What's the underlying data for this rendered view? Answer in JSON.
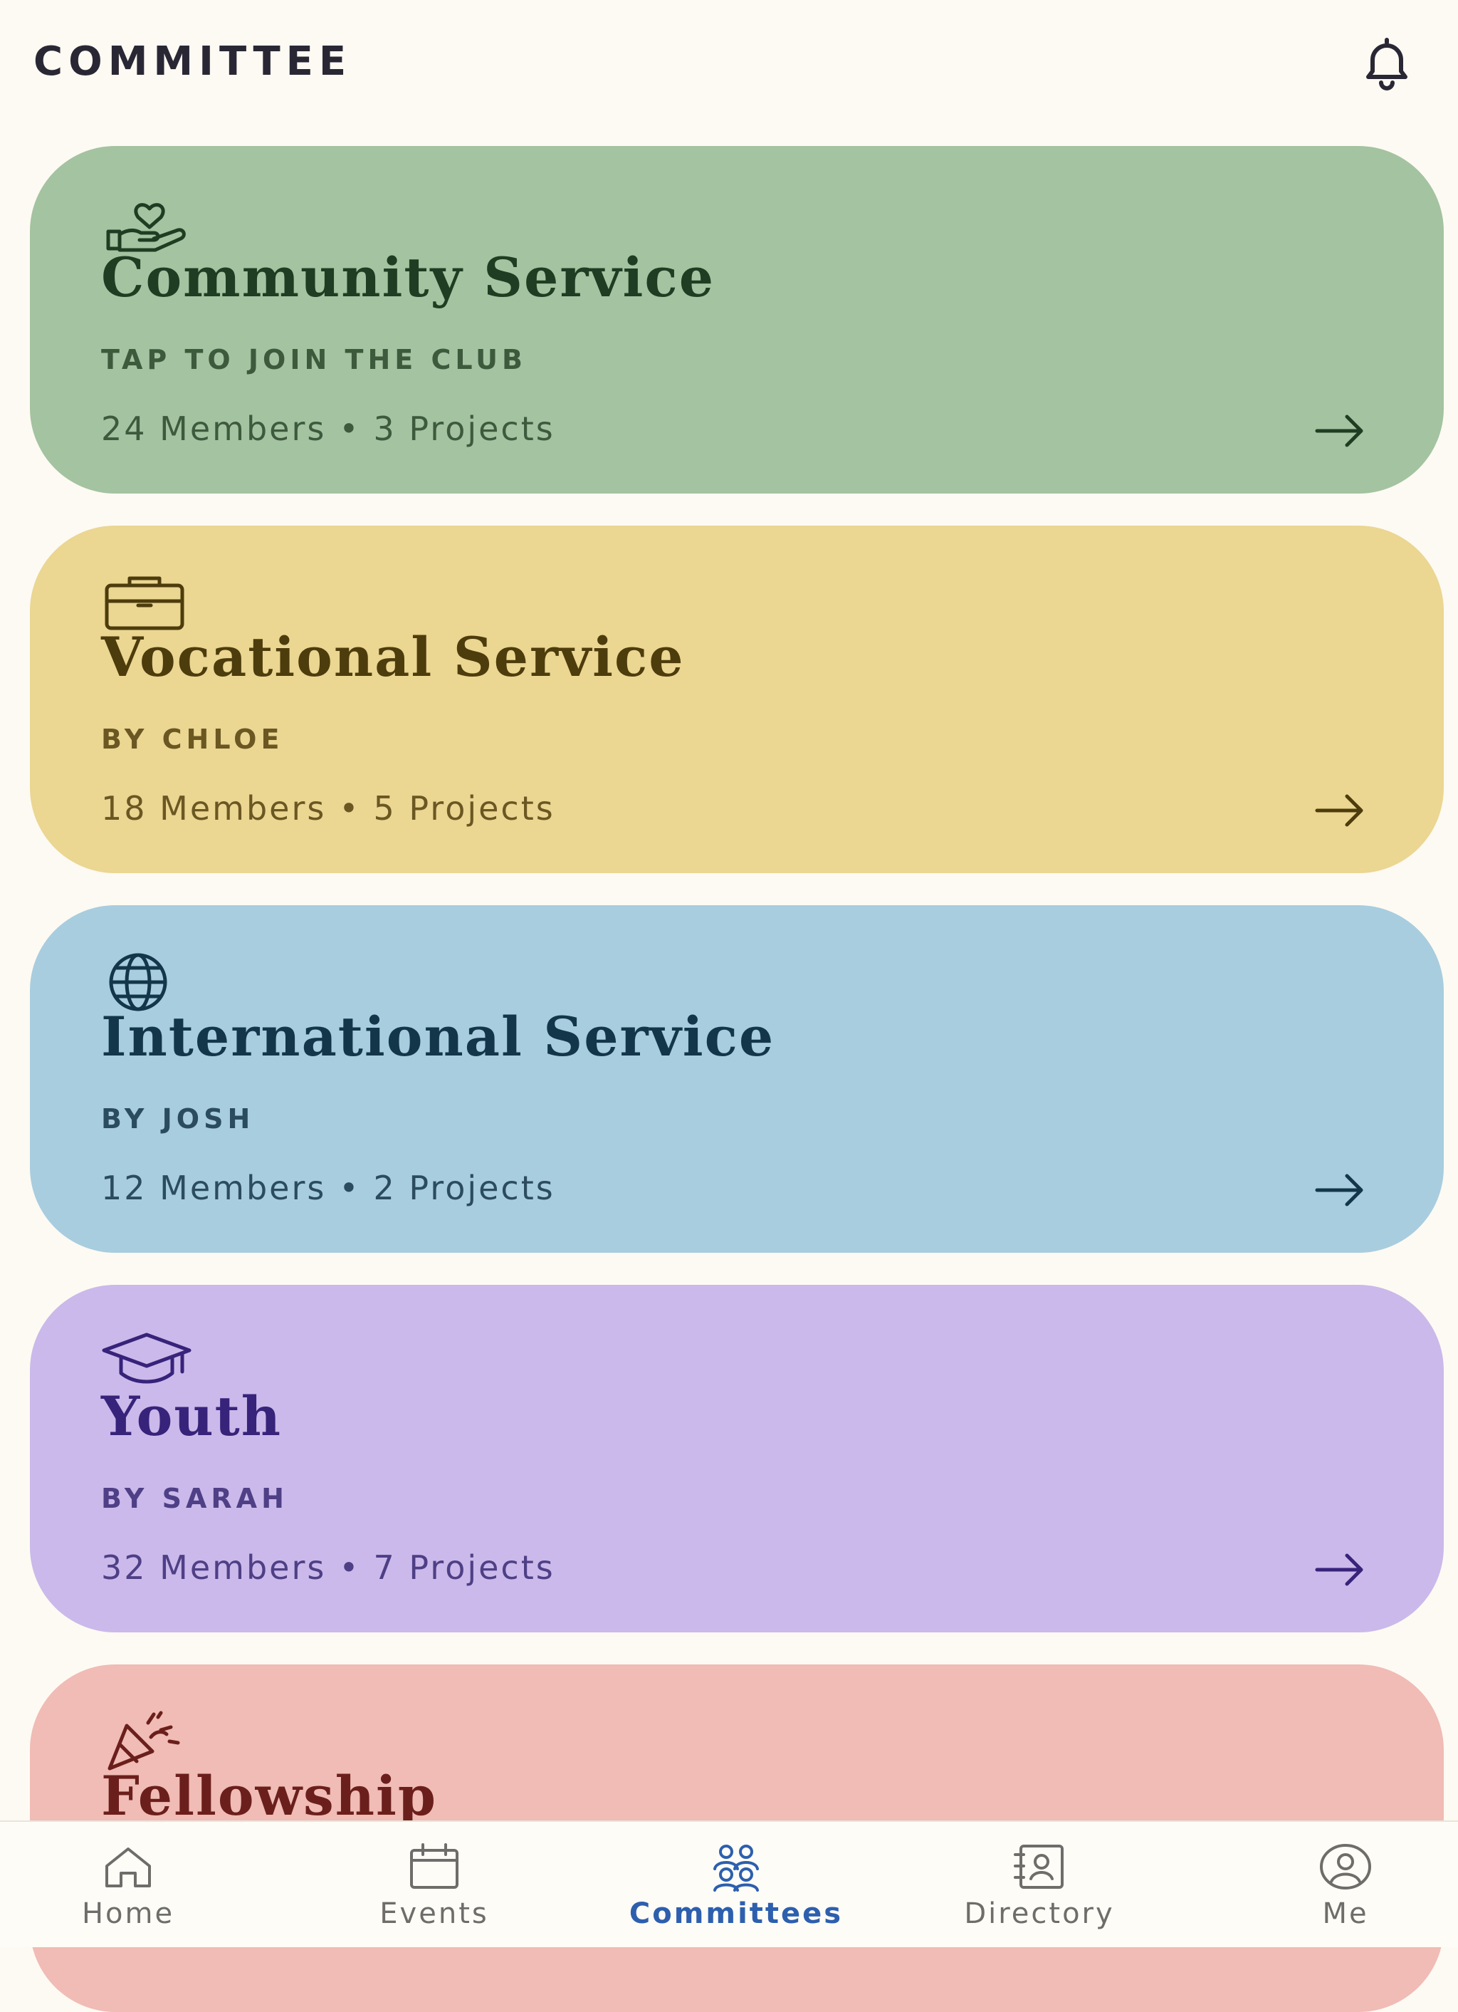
{
  "header": {
    "title": "COMMITTEE",
    "icon": "bell-icon"
  },
  "committees": [
    {
      "icon": "hand-heart-icon",
      "title": "Community Service",
      "subtitle": "TAP TO JOIN THE CLUB",
      "members": "24 Members",
      "projects": "3 Projects",
      "bg": "#a4c3a0",
      "fg": "#1f3d22",
      "sub": "#3d5a3d"
    },
    {
      "icon": "briefcase-icon",
      "title": "Vocational Service",
      "subtitle": "BY CHLOE",
      "members": "18 Members",
      "projects": "5 Projects",
      "bg": "#ebd692",
      "fg": "#4d3c0c",
      "sub": "#6a5722"
    },
    {
      "icon": "globe-icon",
      "title": "International Service",
      "subtitle": "BY JOSH",
      "members": "12 Members",
      "projects": "2 Projects",
      "bg": "#a8cddf",
      "fg": "#14364a",
      "sub": "#2b4c5e"
    },
    {
      "icon": "graduation-cap-icon",
      "title": "Youth",
      "subtitle": "BY SARAH",
      "members": "32 Members",
      "projects": "7 Projects",
      "bg": "#cab9ea",
      "fg": "#37237a",
      "sub": "#4e3f86"
    },
    {
      "icon": "party-popper-icon",
      "title": "Fellowship",
      "subtitle": "",
      "members": "",
      "projects": "",
      "bg": "#f0bcb5",
      "fg": "#6b1f1c",
      "sub": "#7a3a36"
    }
  ],
  "separator": "•",
  "nav": [
    {
      "label": "Home",
      "icon": "home-icon",
      "active": false
    },
    {
      "label": "Events",
      "icon": "calendar-icon",
      "active": false
    },
    {
      "label": "Committees",
      "icon": "users-group-icon",
      "active": true
    },
    {
      "label": "Directory",
      "icon": "contact-book-icon",
      "active": false
    },
    {
      "label": "Me",
      "icon": "user-circle-icon",
      "active": false
    }
  ]
}
